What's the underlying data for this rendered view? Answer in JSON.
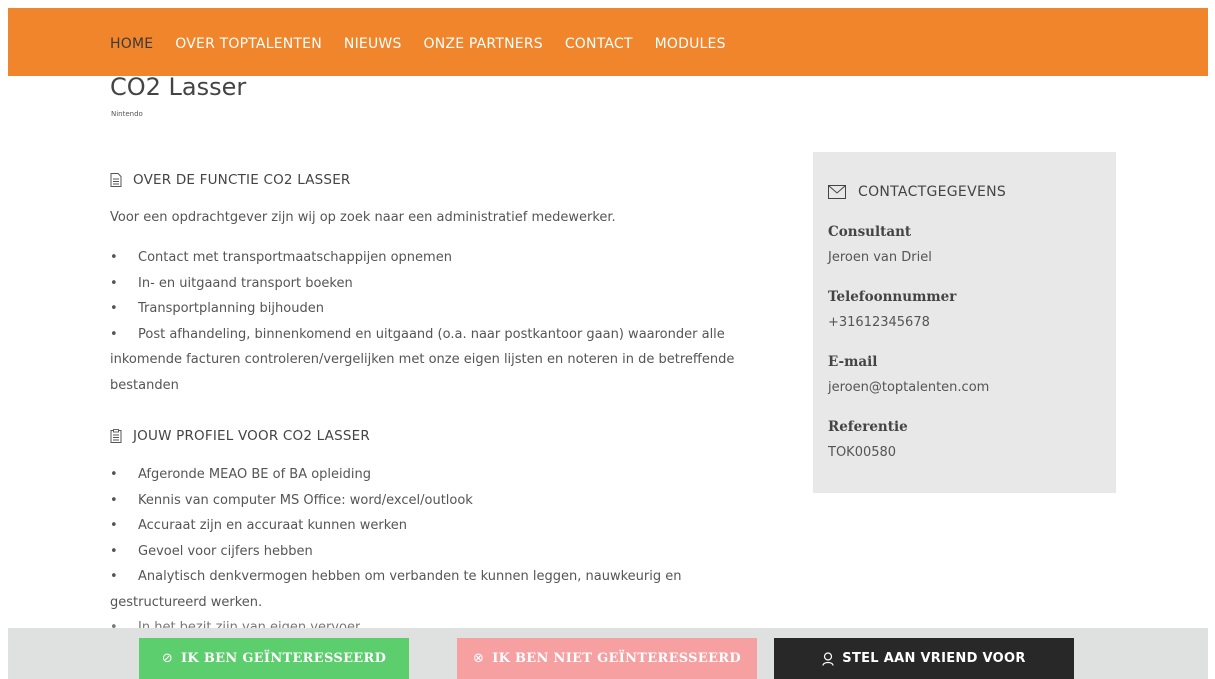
{
  "nav": {
    "items": [
      {
        "label": "HOME"
      },
      {
        "label": "OVER TOPTALENTEN"
      },
      {
        "label": "NIEUWS"
      },
      {
        "label": "ONZE PARTNERS"
      },
      {
        "label": "CONTACT"
      },
      {
        "label": "MODULES"
      }
    ],
    "active": "HOME"
  },
  "job": {
    "title": "CO2 Lasser",
    "company": "Nintendo"
  },
  "about": {
    "heading": "OVER DE FUNCTIE CO2 LASSER",
    "intro": "Voor een opdrachtgever zijn wij op zoek naar een administratief medewerker.",
    "bullets": [
      "Contact met transportmaatschappijen opnemen",
      "In- en uitgaand transport boeken",
      "Transportplanning bijhouden",
      "Post afhandeling, binnenkomend en uitgaand (o.a. naar postkantoor gaan) waaronder alle",
      "inkomende facturen controleren/vergelijken met onze eigen lijsten en noteren in de betreffende",
      "bestanden"
    ]
  },
  "profile": {
    "heading": "JOUW PROFIEL VOOR CO2 LASSER",
    "bullets": [
      "Afgeronde MEAO BE of BA opleiding",
      "Kennis van computer MS Office: word/excel/outlook",
      "Accuraat zijn en accuraat kunnen werken",
      "Gevoel voor cijfers hebben",
      "Analytisch denkvermogen hebben om verbanden te kunnen leggen, nauwkeurig en",
      "gestructureerd werken.",
      "In het bezit zijn van eigen vervoer"
    ]
  },
  "contact": {
    "heading": "CONTACTGEGEVENS",
    "consultant_label": "Consultant",
    "consultant": "Jeroen van Driel",
    "phone_label": "Telefoonnummer",
    "phone": "+31612345678",
    "email_label": "E-mail",
    "email": "jeroen@toptalenten.com",
    "ref_label": "Referentie",
    "ref": "TOK00580"
  },
  "actions": {
    "interested": "IK BEN GEÏNTERESSEERD",
    "not_interested": "IK BEN NIET GEÏNTERESSEERD",
    "recommend": "STEL AAN VRIEND VOOR"
  },
  "colors": {
    "nav_bg": "#f0852c",
    "btn_green": "#5dce6e",
    "btn_pink": "#f6a0a2",
    "btn_dark": "#282828"
  }
}
